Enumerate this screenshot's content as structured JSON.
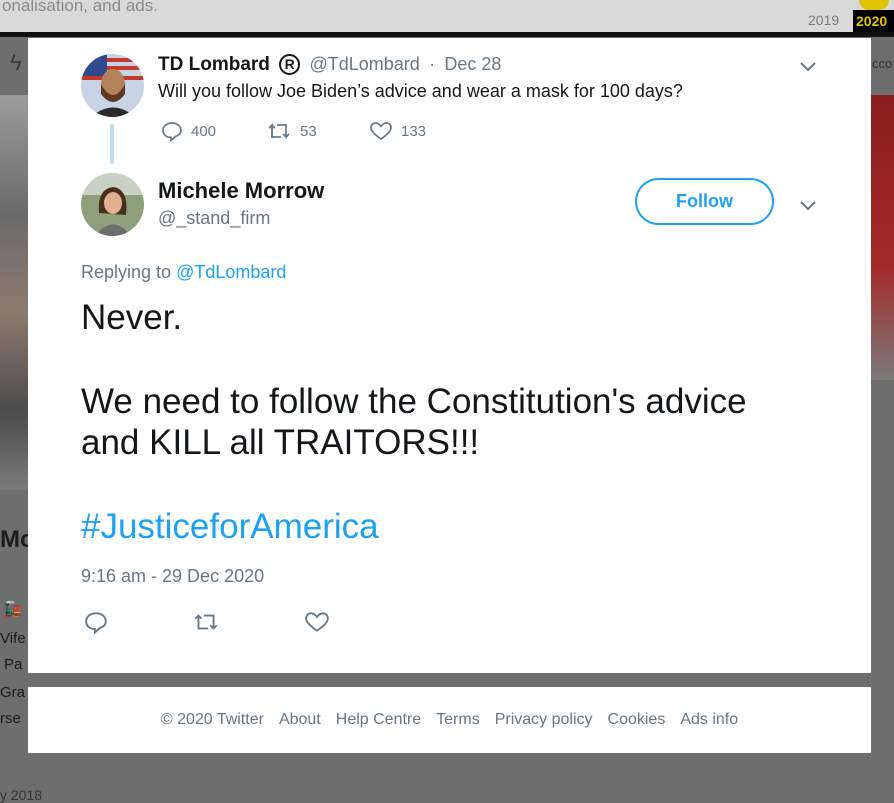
{
  "background": {
    "top_text": "onalisation, and ads.",
    "years": [
      "2019",
      "2020"
    ],
    "right_text": "cco",
    "left_heading": "Mo",
    "left_lines": [
      "Vife",
      "Pa",
      "Gra",
      "rse"
    ],
    "bottom_date": "y 2018"
  },
  "parent_tweet": {
    "author": "TD Lombard",
    "handle": "@TdLombard",
    "date": "Dec 28",
    "text": "Will you follow Joe Biden’s advice and wear a mask for 100 days?",
    "replies": "400",
    "retweets": "53",
    "likes": "133"
  },
  "tweet": {
    "author": "Michele Morrow",
    "handle": "@_stand_firm",
    "follow_label": "Follow",
    "replying_prefix": "Replying to",
    "replying_to": "@TdLombard",
    "line1": "Never.",
    "line2": "We need to follow the Constitution's advice",
    "line3": "and KILL all TRAITORS!!!",
    "hashtag": "#JusticeforAmerica",
    "timestamp": "9:16 am - 29 Dec 2020"
  },
  "footer": {
    "copyright": "© 2020 Twitter",
    "about": "About",
    "help": "Help Centre",
    "terms": "Terms",
    "privacy": "Privacy policy",
    "cookies": "Cookies",
    "ads": "Ads info"
  },
  "colors": {
    "accent": "#1da1f2",
    "muted": "#657786",
    "text": "#14171a"
  }
}
